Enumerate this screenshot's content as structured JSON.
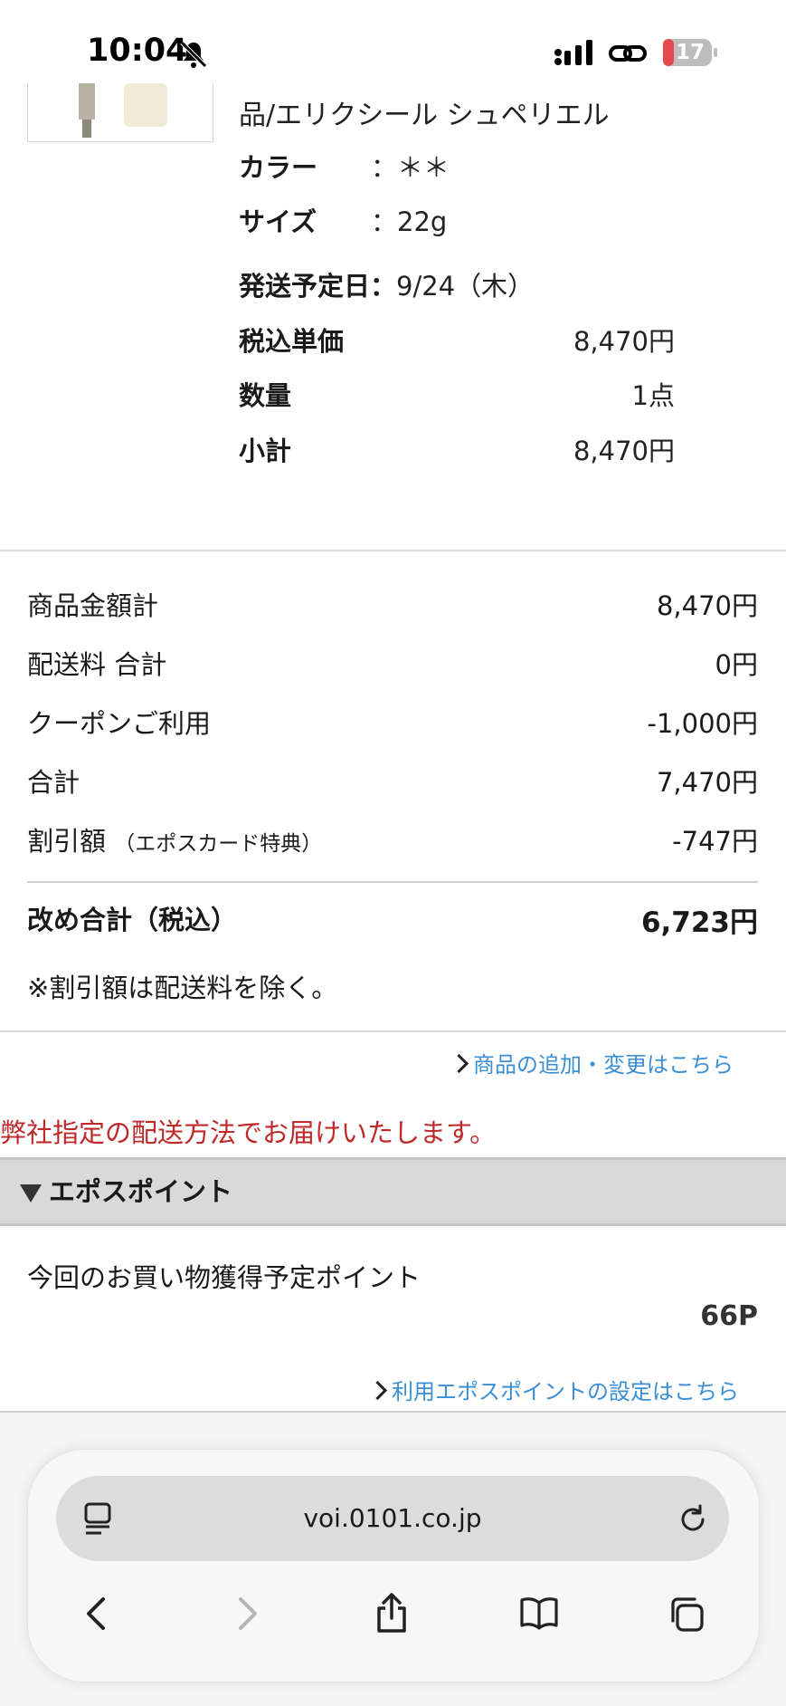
{
  "status_bar": {
    "time": "10:04",
    "battery": "17"
  },
  "product": {
    "name_tail": "品/エリクシール シュペリエル",
    "color_label": "カラー",
    "color_value": "：＊＊",
    "size_label": "サイズ",
    "size_value": "：22g",
    "ship_label": "発送予定日：",
    "ship_value": "9/24（木）",
    "unit_price_label": "税込単価",
    "unit_price_value": "8,470円",
    "qty_label": "数量",
    "qty_value": "1点",
    "subtotal_label": "小計",
    "subtotal_value": "8,470円"
  },
  "summary": {
    "rows": [
      {
        "label": "商品金額計",
        "value": "8,470円"
      },
      {
        "label": "配送料 合計",
        "value": "0円"
      },
      {
        "label": "クーポンご利用",
        "value": "-1,000円"
      },
      {
        "label": "合計",
        "value": "7,470円"
      },
      {
        "label": "割引額",
        "note": "（エポスカード特典）",
        "value": "-747円"
      }
    ],
    "total_label": "改め合計（税込）",
    "total_value": "6,723円",
    "footnote": "※割引額は配送料を除く。"
  },
  "links": {
    "change_items": "商品の追加・変更はこちら",
    "points_setting": "利用エポスポイントの設定はこちら"
  },
  "notice": "弊社指定の配送方法でお届けいたします。",
  "epos": {
    "title": "エポスポイント",
    "earn_label": "今回のお買い物獲得予定ポイント",
    "earn_value": "66P"
  },
  "browser": {
    "url": "voi.0101.co.jp"
  },
  "colors": {
    "link": "#3b8fd4",
    "notice": "#c0292a",
    "battery_low": "#e5484d"
  },
  "icons": [
    "bell-slash-icon",
    "signal-icon",
    "link-icon",
    "battery-icon",
    "reader-icon",
    "reload-icon",
    "back-icon",
    "forward-icon",
    "share-icon",
    "bookmarks-icon",
    "tabs-icon"
  ]
}
